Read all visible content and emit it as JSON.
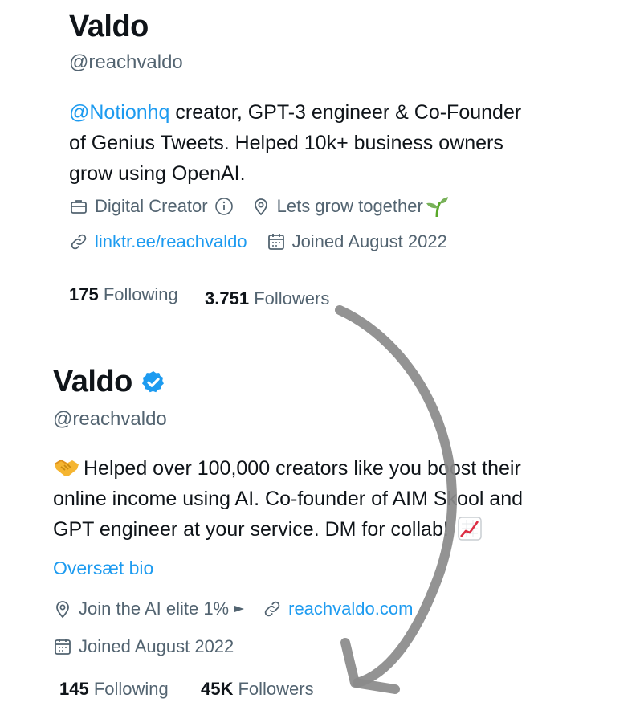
{
  "top_profile": {
    "name": "Valdo",
    "handle": "@reachvaldo",
    "bio_mention": "@Notionhq",
    "bio_line1_rest": " creator, GPT-3 engineer & Co-Founder",
    "bio_line2": "of Genius Tweets. Helped 10k+ business owners",
    "bio_line3": "grow using OpenAI.",
    "category": "Digital Creator",
    "location": "Lets grow together",
    "website": "linktr.ee/reachvaldo",
    "joined": "Joined August 2022",
    "following_count": "175",
    "following_label": "Following",
    "followers_count": "3.751",
    "followers_label": "Followers"
  },
  "bottom_profile": {
    "name": "Valdo",
    "handle": "@reachvaldo",
    "bio_line1": "Helped over 100,000 creators like you boost their",
    "bio_line2": "online income using AI. Co-founder of AIM Skool and",
    "bio_line3": "GPT engineer at your service. DM for collab!",
    "translate_bio": "Oversæt bio",
    "location": "Join the AI elite 1%",
    "website": "reachvaldo.com",
    "joined": "Joined August 2022",
    "following_count": "145",
    "following_label": "Following",
    "followers_count": "45K",
    "followers_label": "Followers"
  },
  "colors": {
    "link": "#1d9bf0",
    "secondary_text": "#536471",
    "primary_text": "#0f1419",
    "arrow": "#8a8a8a",
    "verified_badge": "#1d9bf0"
  },
  "icons": [
    "briefcase-icon",
    "info-icon",
    "location-pin-icon",
    "seedling-emoji",
    "link-icon",
    "calendar-icon",
    "verified-badge-icon",
    "handshake-emoji",
    "chart-increasing-emoji",
    "play-triangle-icon",
    "curved-arrow"
  ]
}
